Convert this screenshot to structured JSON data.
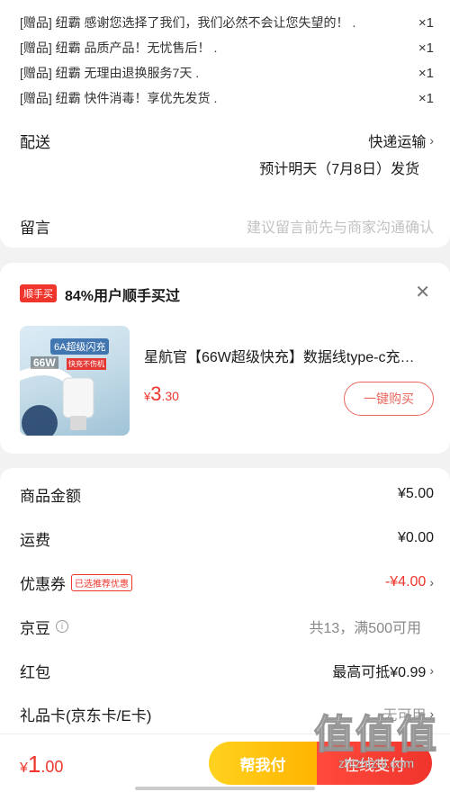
{
  "gifts": [
    {
      "text": "[赠品] 纽霸 感谢您选择了我们，我们必然不会让您失望的！ .",
      "qty": "×1"
    },
    {
      "text": "[赠品] 纽霸 品质产品！无忧售后！ .",
      "qty": "×1"
    },
    {
      "text": "[赠品] 纽霸 无理由退换服务7天 .",
      "qty": "×1"
    },
    {
      "text": "[赠品] 纽霸 快件消毒！享优先发货 .",
      "qty": "×1"
    }
  ],
  "delivery": {
    "label": "配送",
    "method": "快递运输",
    "eta": "预计明天（7月8日）发货"
  },
  "note": {
    "label": "留言",
    "placeholder": "建议留言前先与商家沟通确认"
  },
  "recommend": {
    "badge": "顺手买",
    "text": "84%用户顺手买过",
    "product_title": "星航官【66W超级快充】数据线type-c充…",
    "price_symbol": "¥",
    "price_int": "3",
    "price_dec": ".30",
    "buy_label": "一键购买",
    "image_text_1": "6A超级闪充",
    "image_text_2": "66W",
    "image_text_3": "快充不伤机"
  },
  "summary": {
    "goods_label": "商品金额",
    "goods_value": "¥5.00",
    "freight_label": "运费",
    "freight_value": "¥0.00",
    "coupon_label": "优惠券",
    "coupon_tag": "已选推荐优惠",
    "coupon_value": "-¥4.00",
    "jd_bean_label": "京豆",
    "jd_bean_value": "共13，满500可用",
    "red_packet_label": "红包",
    "red_packet_value": "最高可抵¥0.99",
    "gift_card_label": "礼品卡(京东卡/E卡)",
    "gift_card_value": "无可用"
  },
  "bottom": {
    "total_symbol": "¥",
    "total_int": "1",
    "total_dec": ".00",
    "friend_pay": "帮我付",
    "pay": "在线支付"
  },
  "watermark": {
    "big": "值值值",
    "small": "zhizhizhi.com"
  },
  "colors": {
    "accent": "#f0352c",
    "yellow": "#ffc20e",
    "background": "#f2f2f2"
  }
}
